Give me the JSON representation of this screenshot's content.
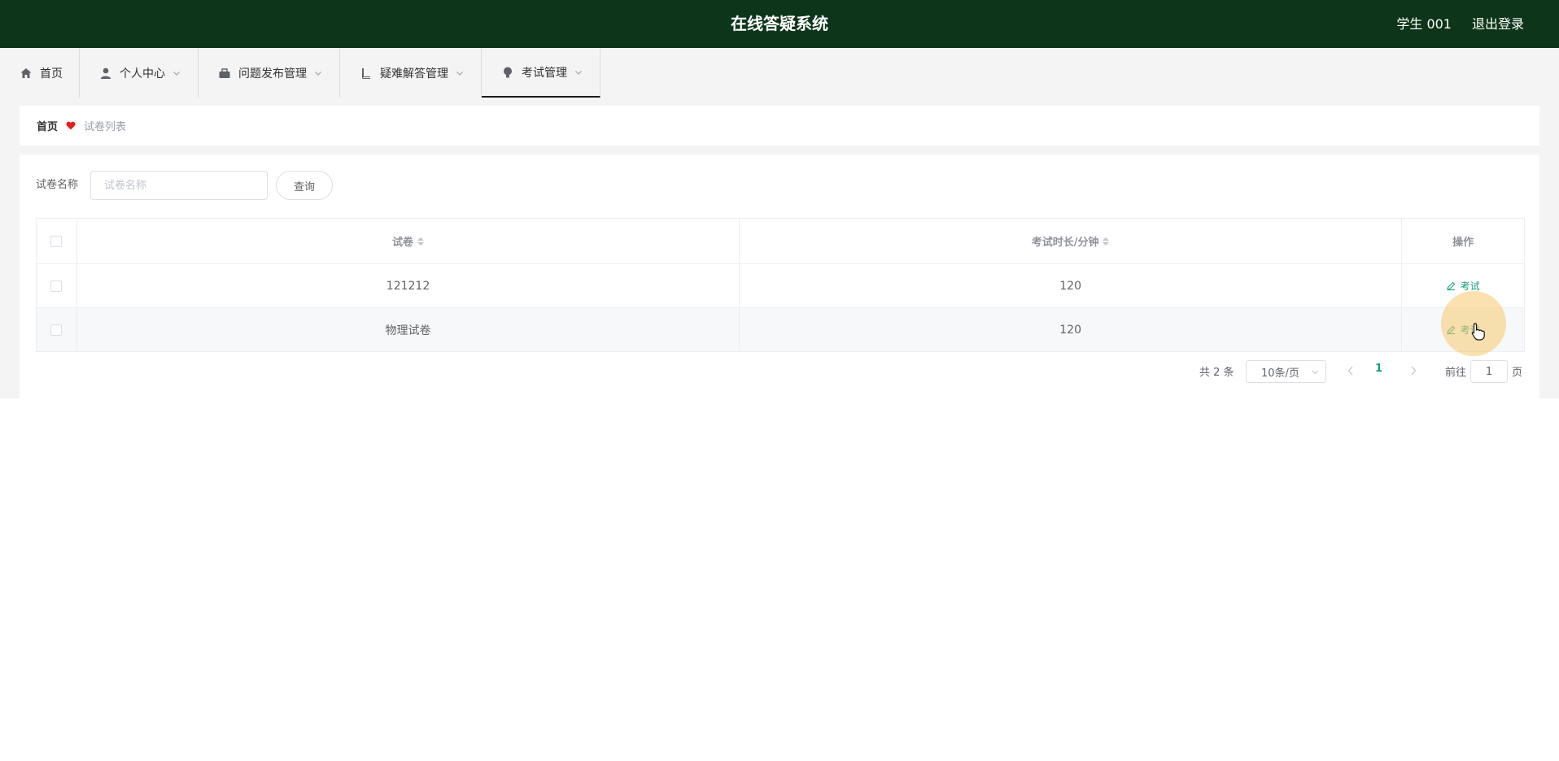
{
  "header": {
    "title": "在线答疑系统",
    "user": "学生 001",
    "logout": "退出登录"
  },
  "nav": {
    "items": [
      {
        "label": "首页",
        "icon": "home-icon",
        "dropdown": false
      },
      {
        "label": "个人中心",
        "icon": "user-icon",
        "dropdown": true
      },
      {
        "label": "问题发布管理",
        "icon": "briefcase-icon",
        "dropdown": true
      },
      {
        "label": "疑难解答管理",
        "icon": "book-icon",
        "dropdown": true
      },
      {
        "label": "考试管理",
        "icon": "lightbulb-icon",
        "dropdown": true,
        "active": true
      }
    ]
  },
  "breadcrumb": {
    "home": "首页",
    "current": "试卷列表",
    "separator_icon": "heart-icon",
    "separator_color": "#e02020"
  },
  "search": {
    "label": "试卷名称",
    "placeholder": "试卷名称",
    "value": "",
    "button": "查询"
  },
  "table": {
    "columns": [
      "试卷",
      "考试时长/分钟",
      "操作"
    ],
    "rows": [
      {
        "name": "121212",
        "duration": "120",
        "action": "考试"
      },
      {
        "name": "物理试卷",
        "duration": "120",
        "action": "考试"
      }
    ]
  },
  "pagination": {
    "total": "共 2 条",
    "page_size": "10条/页",
    "current_page": "1",
    "goto_label": "前往",
    "goto_value": "1",
    "page_suffix": "页"
  },
  "colors": {
    "header_bg": "#0d3519",
    "accent": "#13a07a"
  }
}
